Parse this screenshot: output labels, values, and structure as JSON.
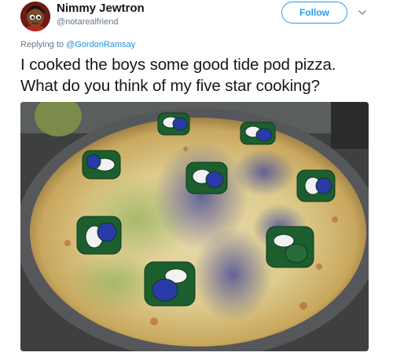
{
  "user": {
    "display_name": "Nimmy Jewtron",
    "handle": "@notarealfriend",
    "avatar_icon": "cartoon-character-avatar"
  },
  "actions": {
    "follow_label": "Follow",
    "more_icon": "chevron-down-icon"
  },
  "reply": {
    "prefix": "Replying to ",
    "mention": "@GordonRamsay"
  },
  "tweet": {
    "line1": "I cooked the boys some good tide pod pizza.",
    "line2": "What do you think of my five star cooking?"
  },
  "media": {
    "description_icon": "pizza-photo"
  },
  "colors": {
    "accent": "#1da1f2",
    "secondary_text": "#657786",
    "primary_text": "#14171a"
  }
}
